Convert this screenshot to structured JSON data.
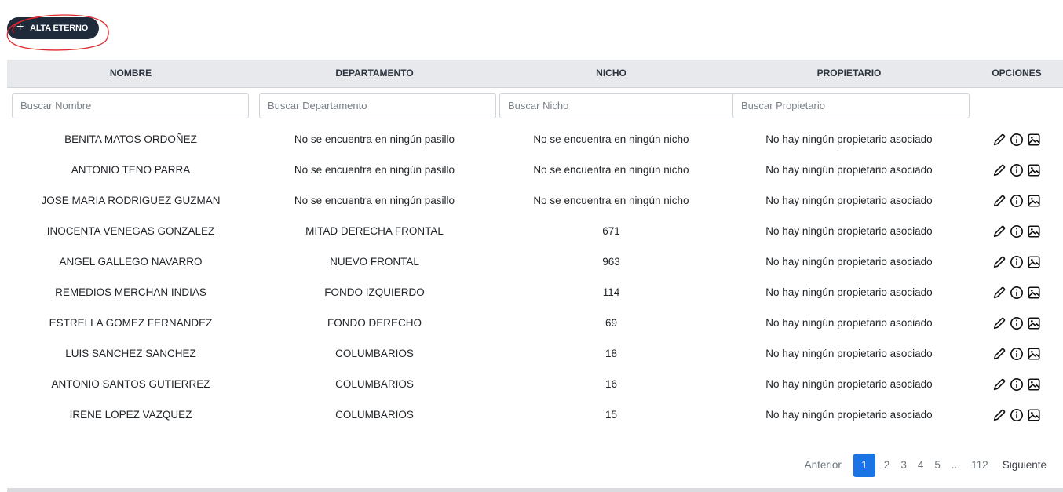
{
  "toolbar": {
    "alta_label": "ALTA ETERNO",
    "plus_glyph": "+"
  },
  "table": {
    "columns": [
      "NOMBRE",
      "DEPARTAMENTO",
      "NICHO",
      "PROPIETARIO",
      "OPCIONES"
    ],
    "filters": {
      "nombre": "Buscar Nombre",
      "departamento": "Buscar Departamento",
      "nicho": "Buscar Nicho",
      "propietario": "Buscar Propietario"
    },
    "rows": [
      [
        "BENITA MATOS ORDOÑEZ",
        "No se encuentra en ningún pasillo",
        "No se encuentra en ningún nicho",
        "No hay ningún propietario asociado"
      ],
      [
        "ANTONIO TENO PARRA",
        "No se encuentra en ningún pasillo",
        "No se encuentra en ningún nicho",
        "No hay ningún propietario asociado"
      ],
      [
        "JOSE MARIA RODRIGUEZ GUZMAN",
        "No se encuentra en ningún pasillo",
        "No se encuentra en ningún nicho",
        "No hay ningún propietario asociado"
      ],
      [
        "INOCENTA VENEGAS GONZALEZ",
        "MITAD DERECHA FRONTAL",
        "671",
        "No hay ningún propietario asociado"
      ],
      [
        "ANGEL GALLEGO NAVARRO",
        "NUEVO FRONTAL",
        "963",
        "No hay ningún propietario asociado"
      ],
      [
        "REMEDIOS MERCHAN INDIAS",
        "FONDO IZQUIERDO",
        "114",
        "No hay ningún propietario asociado"
      ],
      [
        "ESTRELLA GOMEZ FERNANDEZ",
        "FONDO DERECHO",
        "69",
        "No hay ningún propietario asociado"
      ],
      [
        "LUIS SANCHEZ SANCHEZ",
        "COLUMBARIOS",
        "18",
        "No hay ningún propietario asociado"
      ],
      [
        "ANTONIO SANTOS GUTIERREZ",
        "COLUMBARIOS",
        "16",
        "No hay ningún propietario asociado"
      ],
      [
        "IRENE LOPEZ VAZQUEZ",
        "COLUMBARIOS",
        "15",
        "No hay ningún propietario asociado"
      ]
    ],
    "option_icons": [
      "pencil-icon",
      "info-icon",
      "image-icon"
    ]
  },
  "pagination": {
    "prev_label": "Anterior",
    "pages": [
      "1",
      "2",
      "3",
      "4",
      "5",
      "...",
      "112"
    ],
    "active_page": "1",
    "next_label": "Siguiente"
  },
  "colors": {
    "button_bg": "#1f2a3a",
    "active_page": "#1b74e4",
    "header_bg": "#e8e9ec",
    "highlight_circle": "#e0262b"
  }
}
